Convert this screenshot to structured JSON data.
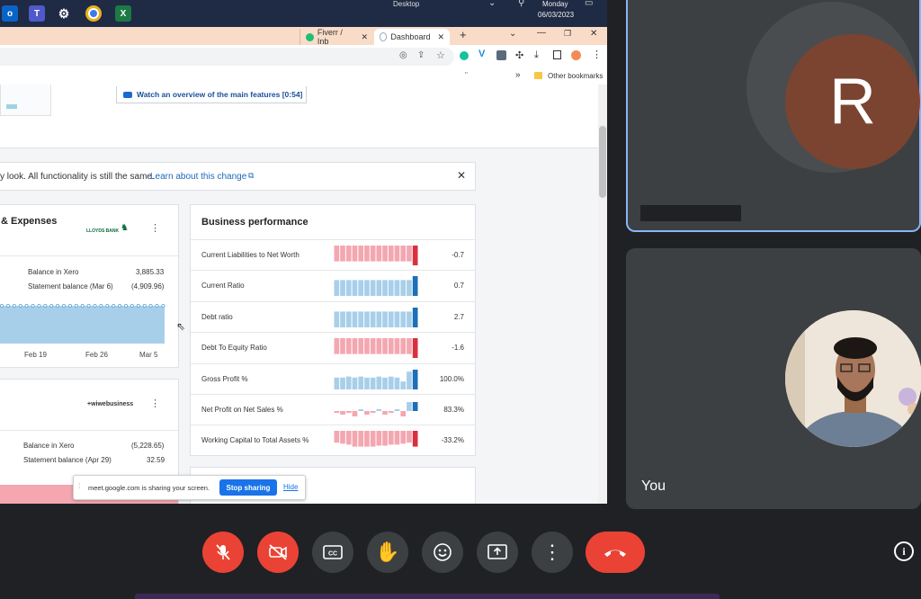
{
  "taskbar": {
    "desktop_label": "Desktop",
    "day": "Monday",
    "date": "06/03/2023"
  },
  "browser": {
    "tabs": [
      {
        "label": "Fiverr / Inb"
      },
      {
        "label": "Dashboard"
      }
    ],
    "bookmarks_label": "Other bookmarks"
  },
  "xero": {
    "video_link": "Watch an overview of the main features [0:54]",
    "notice_text": "y look. All functionality is still the same.",
    "notice_link": "Learn about this change",
    "bank1": {
      "title": "& Expenses",
      "bank_name": "LLOYDS BANK",
      "balance_xero_label": "Balance in Xero",
      "balance_xero_value": "3,885.33",
      "statement_label": "Statement balance (Mar 6)",
      "statement_value": "(4,909.96)",
      "axis_dates": [
        "Feb 19",
        "Feb 26",
        "Mar 5"
      ]
    },
    "bank2": {
      "bank_name": "+wiwebusiness",
      "balance_xero_label": "Balance in Xero",
      "balance_xero_value": "(5,228.65)",
      "statement_label": "Statement balance (Apr 29)",
      "statement_value": "32.59"
    },
    "business_performance": {
      "title": "Business performance",
      "rows": [
        {
          "label": "Current Liabilities to Net Worth",
          "value": "-0.7",
          "kind": "neg",
          "bars": [
            0.8,
            0.8,
            0.8,
            0.8,
            0.8,
            0.8,
            0.8,
            0.8,
            0.8,
            0.8,
            0.8,
            0.8,
            0.8,
            1.0
          ]
        },
        {
          "label": "Current Ratio",
          "value": "0.7",
          "kind": "pos",
          "bars": [
            0.8,
            0.8,
            0.8,
            0.8,
            0.8,
            0.8,
            0.8,
            0.8,
            0.8,
            0.8,
            0.8,
            0.8,
            0.8,
            1.0
          ]
        },
        {
          "label": "Debt ratio",
          "value": "2.7",
          "kind": "pos",
          "bars": [
            0.8,
            0.8,
            0.8,
            0.8,
            0.8,
            0.8,
            0.8,
            0.8,
            0.8,
            0.8,
            0.8,
            0.8,
            0.8,
            1.0
          ]
        },
        {
          "label": "Debt To Equity Ratio",
          "value": "-1.6",
          "kind": "neg",
          "bars": [
            0.8,
            0.8,
            0.8,
            0.8,
            0.8,
            0.8,
            0.8,
            0.8,
            0.8,
            0.8,
            0.8,
            0.8,
            0.8,
            1.0
          ]
        },
        {
          "label": "Gross Profit %",
          "value": "100.0%",
          "kind": "pos",
          "bars": [
            0.6,
            0.6,
            0.65,
            0.6,
            0.65,
            0.6,
            0.6,
            0.65,
            0.6,
            0.65,
            0.6,
            0.4,
            0.9,
            1.0
          ]
        },
        {
          "label": "Net Profit on Net Sales %",
          "value": "83.3%",
          "kind": "mixed",
          "bars": [
            -0.1,
            -0.2,
            -0.1,
            -0.3,
            0.1,
            -0.2,
            -0.1,
            0.1,
            -0.2,
            -0.1,
            0.1,
            -0.3,
            0.5,
            0.5
          ]
        },
        {
          "label": "Working Capital to Total Assets %",
          "value": "-33.2%",
          "kind": "neg",
          "bars": [
            0.6,
            0.65,
            0.7,
            0.8,
            0.8,
            0.8,
            0.8,
            0.75,
            0.75,
            0.7,
            0.7,
            0.65,
            0.6,
            0.8
          ]
        }
      ]
    },
    "share_bar": {
      "text": "meet.google.com is sharing your screen.",
      "stop_label": "Stop sharing",
      "hide_label": "Hide"
    }
  },
  "meet": {
    "remote_initial": "R",
    "you_label": "You"
  },
  "colors": {
    "neg_bar": "#f4a7b0",
    "neg_bar_last": "#d9303e",
    "pos_bar": "#a8cfea",
    "pos_bar_last": "#1c6fb8",
    "avatar_bg": "#7b4430",
    "danger": "#ea4335",
    "ctl_bg": "#3c4043"
  }
}
